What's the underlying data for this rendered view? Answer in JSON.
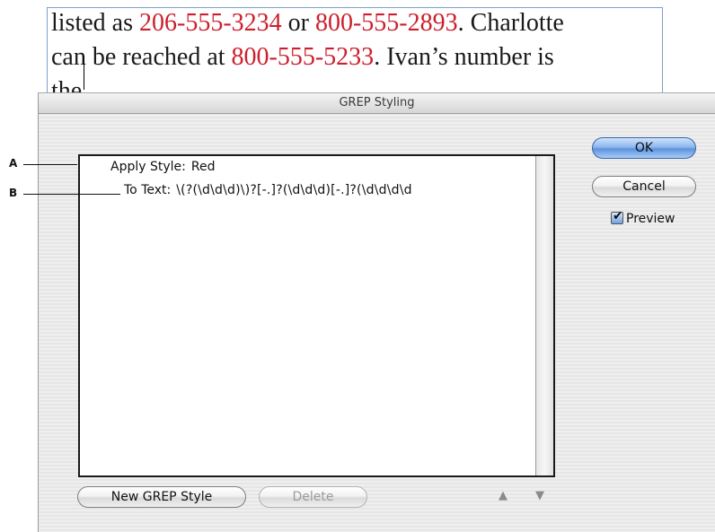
{
  "document": {
    "line1_a": "listed as ",
    "line1_num1": "206-555-3234",
    "line1_b": " or ",
    "line1_num2": "800-555-2893",
    "line1_c": ". Charlotte",
    "line2_a": "can be reached at ",
    "line2_num": "800-555-5233",
    "line2_b": ". Ivan’s number is",
    "line3": "the",
    "highlight_color": "#cc1f2d"
  },
  "dialog": {
    "title": "GREP Styling",
    "rows": [
      {
        "label": "Apply Style:",
        "value": "Red"
      },
      {
        "label": "To Text:",
        "value": "\\(?(\\d\\d\\d)\\)?[-.]?(\\d\\d\\d)[-.]?(\\d\\d\\d\\d"
      }
    ],
    "ok_label": "OK",
    "cancel_label": "Cancel",
    "preview_label": "Preview",
    "preview_checked": true,
    "new_label": "New GREP Style",
    "delete_label": "Delete",
    "up_icon": "▲",
    "down_icon": "▼"
  },
  "callouts": {
    "a": "A",
    "b": "B"
  }
}
